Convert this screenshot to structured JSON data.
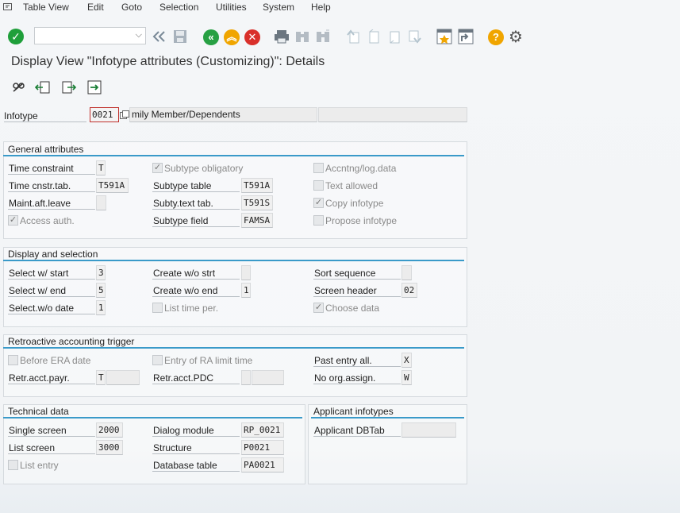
{
  "menu": [
    "Table View",
    "Edit",
    "Goto",
    "Selection",
    "Utilities",
    "System",
    "Help"
  ],
  "page_title": "Display View \"Infotype attributes (Customizing)\": Details",
  "header": {
    "infotype_label": "Infotype",
    "infotype_value": "0021",
    "infotype_text": "mily Member/Dependents"
  },
  "general": {
    "title": "General attributes",
    "time_constraint_label": "Time constraint",
    "time_constraint_value": "T",
    "time_cnstr_tab_label": "Time cnstr.tab.",
    "time_cnstr_tab_value": "T591A",
    "maint_aft_leave_label": "Maint.aft.leave",
    "access_auth_label": "Access auth.",
    "subtype_obligatory_label": "Subtype obligatory",
    "subtype_table_label": "Subtype table",
    "subtype_table_value": "T591A",
    "subty_text_tab_label": "Subty.text tab.",
    "subty_text_tab_value": "T591S",
    "subtype_field_label": "Subtype field",
    "subtype_field_value": "FAMSA",
    "accntng_label": "Accntng/log.data",
    "text_allowed_label": "Text allowed",
    "copy_infotype_label": "Copy infotype",
    "propose_infotype_label": "Propose infotype"
  },
  "display": {
    "title": "Display and selection",
    "select_w_start_label": "Select w/ start",
    "select_w_start_value": "3",
    "select_w_end_label": "Select w/ end",
    "select_w_end_value": "5",
    "select_wo_date_label": "Select.w/o date",
    "select_wo_date_value": "1",
    "create_wo_strt_label": "Create w/o strt",
    "create_wo_end_label": "Create w/o end",
    "create_wo_end_value": "1",
    "list_time_per_label": "List time per.",
    "sort_sequence_label": "Sort sequence",
    "screen_header_label": "Screen header",
    "screen_header_value": "02",
    "choose_data_label": "Choose data"
  },
  "retro": {
    "title": "Retroactive accounting trigger",
    "before_era_label": "Before ERA date",
    "retr_acct_payr_label": "Retr.acct.payr.",
    "retr_acct_payr_value": "T",
    "entry_ra_label": "Entry of RA limit time",
    "retr_acct_pdc_label": "Retr.acct.PDC",
    "past_entry_label": "Past entry all.",
    "past_entry_value": "X",
    "no_org_label": "No org.assign.",
    "no_org_value": "W"
  },
  "technical": {
    "title": "Technical data",
    "single_screen_label": "Single screen",
    "single_screen_value": "2000",
    "list_screen_label": "List screen",
    "list_screen_value": "3000",
    "list_entry_label": "List entry",
    "dialog_module_label": "Dialog module",
    "dialog_module_value": "RP_0021",
    "structure_label": "Structure",
    "structure_value": "P0021",
    "database_table_label": "Database table",
    "database_table_value": "PA0021"
  },
  "applicant": {
    "title": "Applicant infotypes",
    "dbtab_label": "Applicant DBTab"
  },
  "colors": {
    "accent": "#3a9ac9",
    "ok_green": "#1f9f3a",
    "nav_green": "#27a043",
    "warn_orange": "#f0a500",
    "cancel_red": "#d9302b",
    "help_orange": "#f0a500"
  }
}
